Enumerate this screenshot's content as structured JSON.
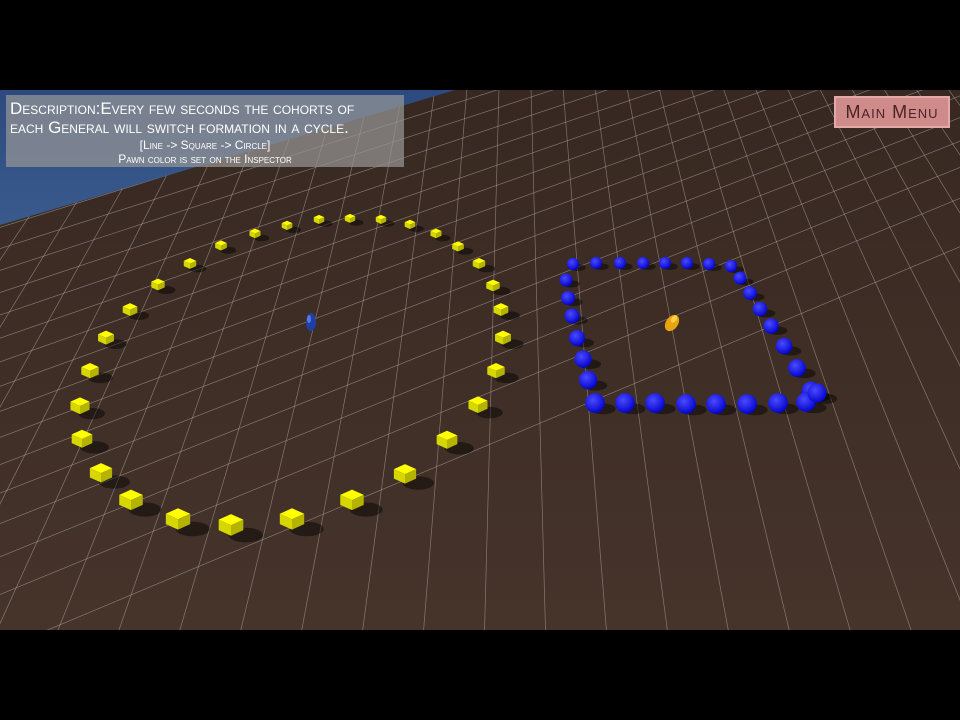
{
  "description": {
    "label": "Description:",
    "line1_rest": "Every few seconds the cohorts of",
    "line2": "each General will switch formation in a cycle.",
    "line3": "[Line -> Square -> Circle]",
    "line4": "Pawn color is set on the Inspector"
  },
  "menu": {
    "main_menu_label": "Main Menu"
  },
  "colors": {
    "sky": "#2f4d82",
    "ground": "#3b2a23",
    "grid": "#b9b3ae",
    "yellow_pawn": "#ffff00",
    "blue_pawn": "#0000ff",
    "button_bg": "#cf8a8a",
    "button_text": "#4a2424"
  },
  "scene": {
    "yellow_cohort_formation": "circle",
    "blue_cohort_formation": "square",
    "yellow_general_color": "blue",
    "blue_general_color": "yellow"
  }
}
